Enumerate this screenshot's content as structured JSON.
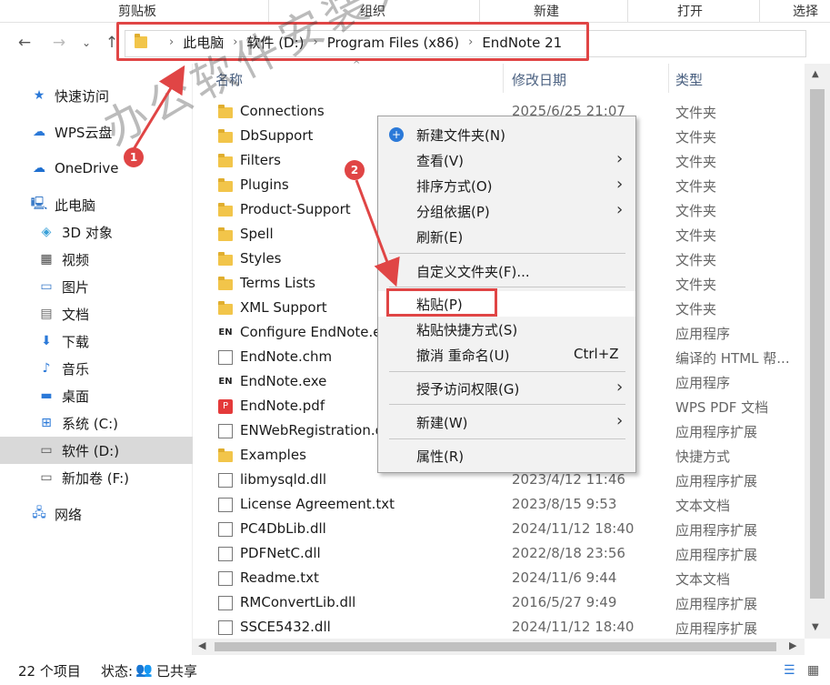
{
  "ribbon": {
    "groups": [
      "剪贴板",
      "组织",
      "新建",
      "打开",
      "选择"
    ]
  },
  "address": {
    "crumbs": [
      "此电脑",
      "软件 (D:)",
      "Program Files (x86)",
      "EndNote 21"
    ]
  },
  "nav": {
    "items": [
      {
        "label": "快速访问",
        "icon": "star-icon"
      },
      {
        "label": "WPS云盘",
        "icon": "cloud-icon"
      },
      {
        "label": "OneDrive",
        "icon": "cloud-icon"
      },
      {
        "label": "此电脑",
        "icon": "computer-icon"
      },
      {
        "label": "3D 对象",
        "icon": "cube-icon"
      },
      {
        "label": "视频",
        "icon": "film-icon"
      },
      {
        "label": "图片",
        "icon": "picture-icon"
      },
      {
        "label": "文档",
        "icon": "document-icon"
      },
      {
        "label": "下载",
        "icon": "download-icon"
      },
      {
        "label": "音乐",
        "icon": "music-icon"
      },
      {
        "label": "桌面",
        "icon": "desktop-icon"
      },
      {
        "label": "系统 (C:)",
        "icon": "drive-icon"
      },
      {
        "label": "软件 (D:)",
        "icon": "drive-icon",
        "selected": true
      },
      {
        "label": "新加卷 (F:)",
        "icon": "drive-icon"
      },
      {
        "label": "网络",
        "icon": "network-icon"
      }
    ]
  },
  "columns": {
    "name": "名称",
    "date": "修改日期",
    "type": "类型"
  },
  "files": [
    {
      "name": "Connections",
      "date": "2025/6/25 21:07",
      "type": "文件夹",
      "icon": "folder"
    },
    {
      "name": "DbSupport",
      "date": "",
      "type": "文件夹",
      "icon": "folder"
    },
    {
      "name": "Filters",
      "date": "",
      "type": "文件夹",
      "icon": "folder"
    },
    {
      "name": "Plugins",
      "date": "",
      "type": "文件夹",
      "icon": "folder"
    },
    {
      "name": "Product-Support",
      "date": "",
      "type": "文件夹",
      "icon": "folder"
    },
    {
      "name": "Spell",
      "date": "",
      "type": "文件夹",
      "icon": "folder"
    },
    {
      "name": "Styles",
      "date": "",
      "type": "文件夹",
      "icon": "folder"
    },
    {
      "name": "Terms Lists",
      "date": "",
      "type": "文件夹",
      "icon": "folder"
    },
    {
      "name": "XML Support",
      "date": "",
      "type": "文件夹",
      "icon": "folder"
    },
    {
      "name": "Configure EndNote.e",
      "date": "",
      "type": "应用程序",
      "icon": "exe"
    },
    {
      "name": "EndNote.chm",
      "date": "",
      "type": "编译的 HTML 帮...",
      "icon": "doc"
    },
    {
      "name": "EndNote.exe",
      "date": "",
      "type": "应用程序",
      "icon": "exe"
    },
    {
      "name": "EndNote.pdf",
      "date": "",
      "type": "WPS PDF 文档",
      "icon": "pdf"
    },
    {
      "name": "ENWebRegistration.d",
      "date": "",
      "type": "应用程序扩展",
      "icon": "doc"
    },
    {
      "name": "Examples",
      "date": "",
      "type": "快捷方式",
      "icon": "folder"
    },
    {
      "name": "libmysqld.dll",
      "date": "2023/4/12 11:46",
      "type": "应用程序扩展",
      "icon": "doc"
    },
    {
      "name": "License Agreement.txt",
      "date": "2023/8/15 9:53",
      "type": "文本文档",
      "icon": "doc"
    },
    {
      "name": "PC4DbLib.dll",
      "date": "2024/11/12 18:40",
      "type": "应用程序扩展",
      "icon": "doc"
    },
    {
      "name": "PDFNetC.dll",
      "date": "2022/8/18 23:56",
      "type": "应用程序扩展",
      "icon": "doc"
    },
    {
      "name": "Readme.txt",
      "date": "2024/11/6 9:44",
      "type": "文本文档",
      "icon": "doc"
    },
    {
      "name": "RMConvertLib.dll",
      "date": "2016/5/27 9:49",
      "type": "应用程序扩展",
      "icon": "doc"
    },
    {
      "name": "SSCE5432.dll",
      "date": "2024/11/12 18:40",
      "type": "应用程序扩展",
      "icon": "doc"
    }
  ],
  "menu": {
    "new_folder": "新建文件夹(N)",
    "view": "查看(V)",
    "sort": "排序方式(O)",
    "group": "分组依据(P)",
    "refresh": "刷新(E)",
    "customize": "自定义文件夹(F)...",
    "paste": "粘贴(P)",
    "paste_shortcut": "粘贴快捷方式(S)",
    "undo": "撤消 重命名(U)",
    "undo_shortcut": "Ctrl+Z",
    "grant": "授予访问权限(G)",
    "new": "新建(W)",
    "properties": "属性(R)"
  },
  "status": {
    "count": "22 个项目",
    "state": "状态:",
    "shared": "已共享"
  },
  "annotations": {
    "badge1": "1",
    "badge2": "2"
  },
  "watermark": "办公软件安装大师",
  "colors": {
    "highlight": "#e04545",
    "selected_row": "#d9d9d9",
    "accent": "#2b79d8"
  }
}
